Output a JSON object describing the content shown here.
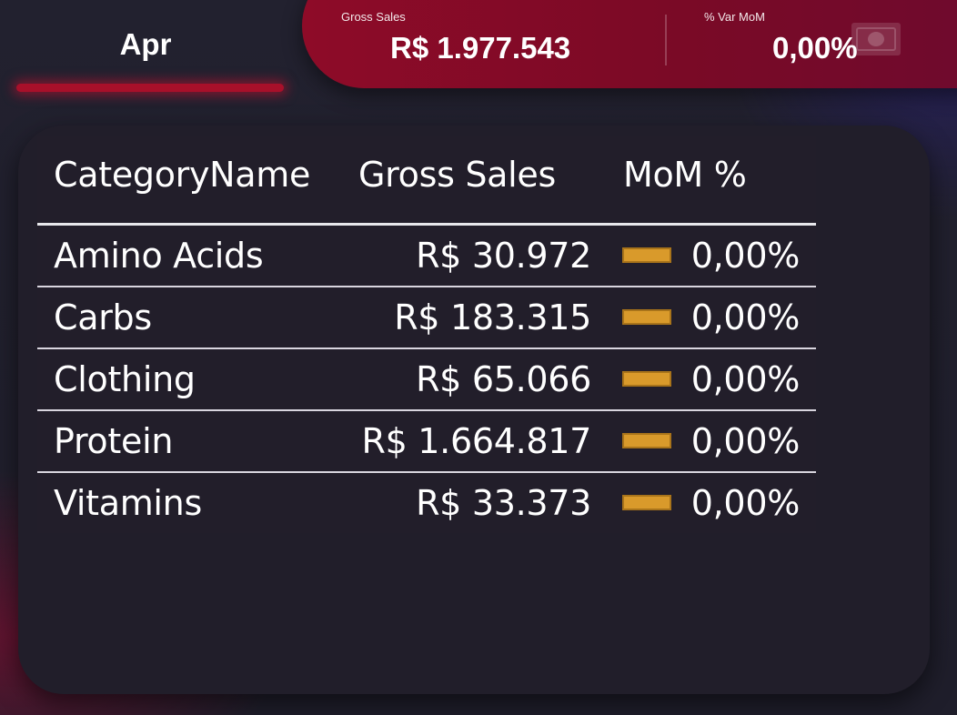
{
  "month": {
    "label": "Apr"
  },
  "kpis": {
    "gross_sales": {
      "title": "Gross Sales",
      "value": "R$ 1.977.543"
    },
    "var_mom": {
      "title": "% Var MoM",
      "value": "0,00%"
    }
  },
  "table": {
    "headers": [
      "CategoryName",
      "Gross Sales",
      "MoM %"
    ],
    "rows": [
      {
        "name": "Amino Acids",
        "sales": "R$ 30.972",
        "mom": "0,00%",
        "trend_icon": "flat-bar-icon"
      },
      {
        "name": "Carbs",
        "sales": "R$ 183.315",
        "mom": "0,00%",
        "trend_icon": "flat-bar-icon"
      },
      {
        "name": "Clothing",
        "sales": "R$ 65.066",
        "mom": "0,00%",
        "trend_icon": "flat-bar-icon"
      },
      {
        "name": "Protein",
        "sales": "R$ 1.664.817",
        "mom": "0,00%",
        "trend_icon": "flat-bar-icon"
      },
      {
        "name": "Vitamins",
        "sales": "R$ 33.373",
        "mom": "0,00%",
        "trend_icon": "flat-bar-icon"
      }
    ]
  },
  "colors": {
    "accent": "#8e0b28",
    "flat_indicator": "#d99a2b"
  },
  "icons": {
    "kpi_icon": "money-bill-icon"
  }
}
